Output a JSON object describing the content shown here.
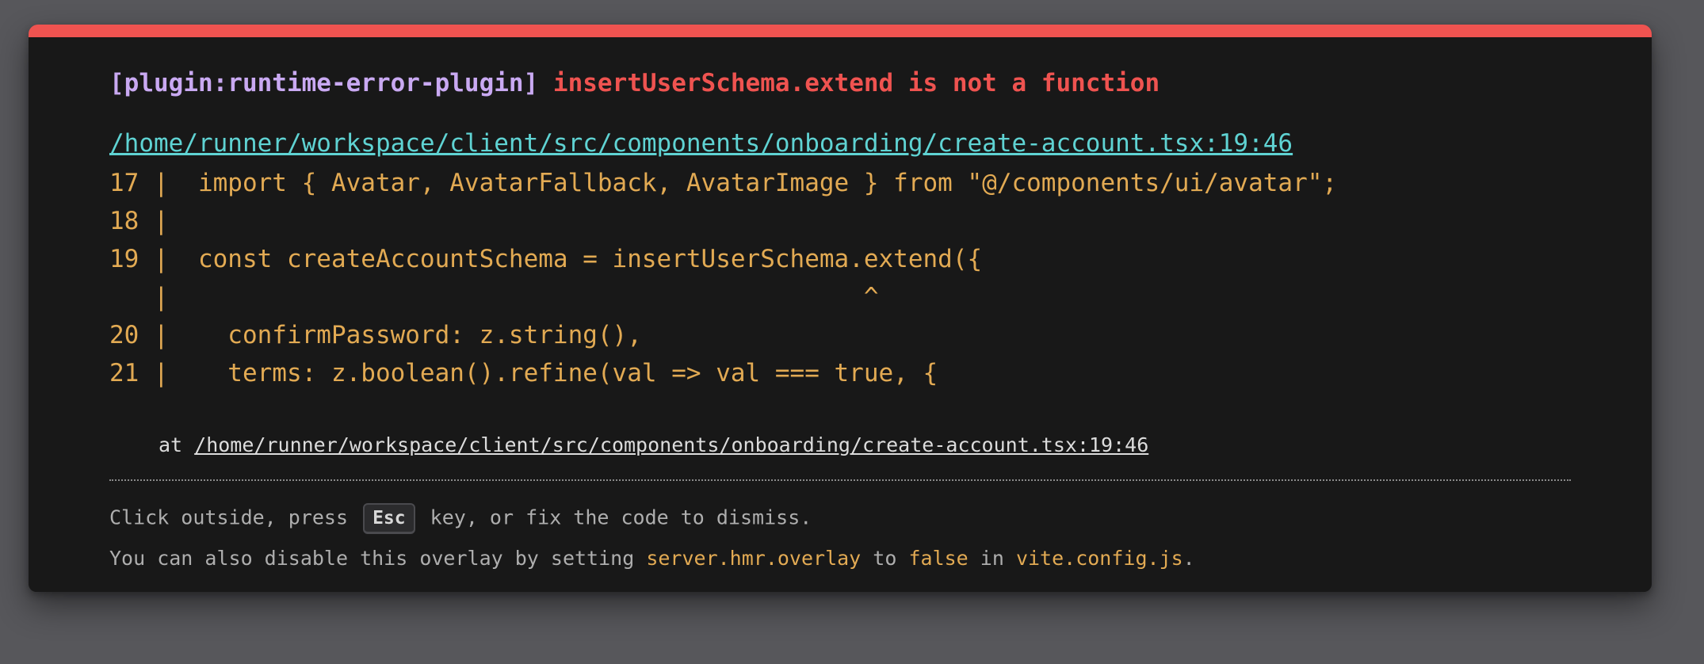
{
  "error": {
    "plugin_label": "[plugin:runtime-error-plugin]",
    "message": "insertUserSchema.extend is not a function",
    "file": "/home/runner/workspace/client/src/components/onboarding/create-account.tsx:19:46"
  },
  "code_frame": [
    "17 |  import { Avatar, AvatarFallback, AvatarImage } from \"@/components/ui/avatar\";",
    "18 |",
    "19 |  const createAccountSchema = insertUserSchema.extend({",
    "   |                                               ^",
    "20 |    confirmPassword: z.string(),",
    "21 |    terms: z.boolean().refine(val => val === true, {"
  ],
  "stack": {
    "prefix": "at ",
    "location": "/home/runner/workspace/client/src/components/onboarding/create-account.tsx:19:46"
  },
  "tip": {
    "line1_before": "Click outside, press ",
    "esc_key": "Esc",
    "line1_after": " key, or fix the code to dismiss.",
    "line2_before": "You can also disable this overlay by setting ",
    "setting": "server.hmr.overlay",
    "line2_middle": " to ",
    "value": "false",
    "line2_in": " in ",
    "config_file": "vite.config.js",
    "line2_end": "."
  },
  "colors": {
    "accent_bar": "#ef5350",
    "plugin": "#c9a9f2",
    "message": "#ef5350",
    "link": "#5fd3d3",
    "code": "#e2aa53",
    "background": "#181818"
  }
}
